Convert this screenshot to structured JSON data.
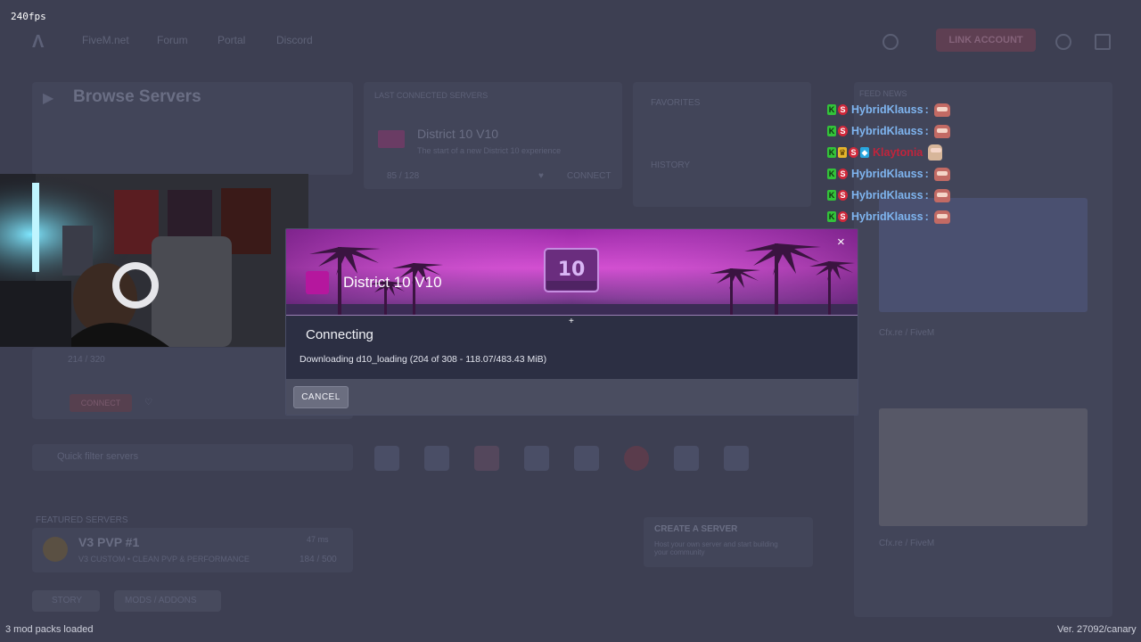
{
  "overlay": {
    "fps": "240fps"
  },
  "nav": {
    "links": [
      "FiveM.net",
      "Forum",
      "Portal",
      "Discord"
    ],
    "link_account": "LINK ACCOUNT"
  },
  "browse": {
    "title": "Browse Servers"
  },
  "last_connected": {
    "header": "LAST CONNECTED SERVERS",
    "server_name": "District 10 V10",
    "server_desc": "The start of a new District 10 experience",
    "players": "85 / 128",
    "connect": "CONNECT"
  },
  "favorites": {
    "header": "FAVORITES",
    "history": "HISTORY"
  },
  "left_card": {
    "players": "214 / 320",
    "connect": "CONNECT"
  },
  "featured": {
    "header": "FEATURED SERVERS",
    "name": "V3 PVP #1",
    "desc": "V3 CUSTOM • CLEAN PVP & PERFORMANCE",
    "players": "184 / 500",
    "ping": "47 ms",
    "btn_story": "STORY",
    "btn_mods": "MODS / ADDONS"
  },
  "quick_search": "Quick filter servers",
  "create_server": {
    "title": "CREATE A SERVER",
    "desc": "Host your own server and start building your community"
  },
  "feed": {
    "title": "FEED NEWS",
    "author": "Cfx.re / FiveM"
  },
  "chat": [
    {
      "name": "HybridKlauss",
      "color_class": "",
      "badges": [
        "K",
        "S"
      ],
      "emote": "pig"
    },
    {
      "name": "HybridKlauss",
      "color_class": "",
      "badges": [
        "K",
        "S"
      ],
      "emote": "pig"
    },
    {
      "name": "Klaytonia",
      "color_class": "red",
      "badges": [
        "K",
        "crown",
        "S",
        "cube"
      ],
      "emote": "face"
    },
    {
      "name": "HybridKlauss",
      "color_class": "",
      "badges": [
        "K",
        "S"
      ],
      "emote": "pig"
    },
    {
      "name": "HybridKlauss",
      "color_class": "",
      "badges": [
        "K",
        "S"
      ],
      "emote": "pig"
    },
    {
      "name": "HybridKlauss",
      "color_class": "",
      "badges": [
        "K",
        "S"
      ],
      "emote": "pig"
    }
  ],
  "modal": {
    "server_title": "District 10 V10",
    "status_title": "Connecting",
    "status_text": "Downloading d10_loading (204 of 308 - 118.07/483.43 MiB)",
    "progress": 0.244,
    "cancel_label": "CANCEL",
    "close_symbol": "×"
  },
  "status_bar": {
    "mods_loaded": "3 mod packs loaded",
    "version": "Ver. 27092/canary"
  },
  "colors": {
    "accent_pink": "#b5179e",
    "modal_bg": "#2c2f43"
  }
}
